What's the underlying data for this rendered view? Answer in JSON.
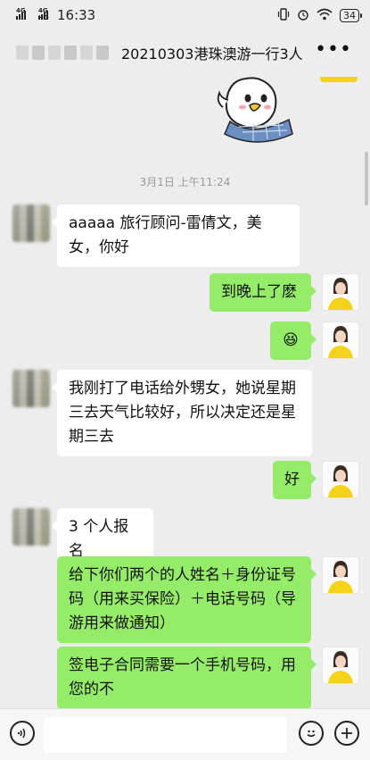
{
  "status_bar": {
    "signal1_label": "4G",
    "signal2_label": "4G HD",
    "time": "16:33",
    "battery": "34"
  },
  "header": {
    "title": "20210303港珠澳游一行3人",
    "more_icon": "more-dots-icon"
  },
  "timestamp": "3月1日 上午11:24",
  "messages": [
    {
      "side": "left",
      "text": "aaaaa 旅行顾问-雷倩文，美女，你好"
    },
    {
      "side": "right",
      "text": "到晚上了麽"
    },
    {
      "side": "right",
      "text": "😆"
    },
    {
      "side": "left",
      "text": "我刚打了电话给外甥女，她说星期三去天气比较好，所以决定还是星期三去"
    },
    {
      "side": "right",
      "text": "好"
    },
    {
      "side": "left",
      "text": "3 个人报名"
    },
    {
      "side": "right",
      "text": "给下你们两个的人姓名＋身份证号码（用来买保险）＋电话号码（导游用来做通知）"
    },
    {
      "side": "right",
      "text": "签电子合同需要一个手机号码，用您的不"
    }
  ],
  "input_bar": {
    "voice_icon": "voice-icon",
    "emoji_icon": "emoji-icon",
    "plus_icon": "plus-icon",
    "input_value": ""
  },
  "colors": {
    "background": "#ededed",
    "bubble_out": "#95ec69",
    "bubble_in": "#ffffff",
    "avatar_shirt": "#f4d21a"
  }
}
